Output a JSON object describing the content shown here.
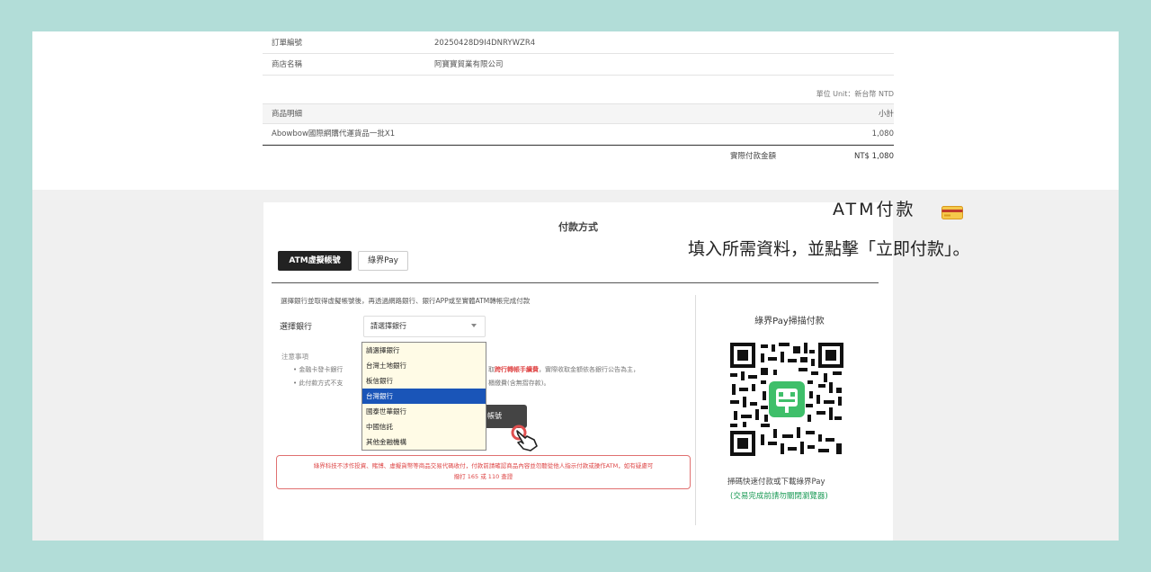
{
  "order": {
    "rows": [
      {
        "label": "訂單編號",
        "value": "20250428D9I4DNRYWZR4"
      },
      {
        "label": "商店名稱",
        "value": "阿寶寶貿業有限公司"
      }
    ],
    "unit_label": "單位 Unit：新台幣 NTD",
    "detail_header": {
      "label": "商品明細",
      "subtotal": "小計"
    },
    "item": {
      "name": "Abowbow國際網購代運貨品一批X1",
      "price": "1,080"
    },
    "total": {
      "label": "實際付款金額",
      "value": "NT$ 1,080"
    }
  },
  "payment": {
    "title": "付款方式",
    "tabs": [
      {
        "label": "ATM虛擬帳號",
        "active": true
      },
      {
        "label": "綠界Pay",
        "active": false
      }
    ],
    "instruction": "選擇銀行並取得虛擬帳號後，再透過網路銀行、銀行APP或至實體ATM轉帳完成付款",
    "bank_label": "選擇銀行",
    "bank_select_value": "請選擇銀行",
    "dropdown_options": [
      "請選擇銀行",
      "台灣土地銀行",
      "板信銀行",
      "台灣銀行",
      "國泰世華銀行",
      "中國信託",
      "其他金融機構"
    ],
    "dropdown_selected_index": 3,
    "notes_title": "注意事項",
    "note1_pre": "• 金融卡發卡銀行",
    "note1_mid": "取",
    "note1_red": "跨行轉帳手續費",
    "note1_post": "，實際收取金額依各銀行公告為主，",
    "note2_pre": "• 此付款方式不支",
    "note2_post": "櫃繳費(含無摺存款)。",
    "generate_button_tail": "帳號",
    "warning_line1": "綠界科技不涉作投資、賭博、虛擬貨幣等商品交易代碼收付，付款前請確認商品內容並勿聽從他人指示付款或操作ATM，如有疑慮可",
    "warning_line2": "撥打 165 或 110 查證",
    "qr_title": "綠界Pay掃描付款",
    "qr_caption": "掃碼快速付款或下載綠界Pay",
    "qr_caption2": "(交易完成前請勿關閉瀏覽器)"
  },
  "annotation": {
    "title": "ATM付款",
    "subtitle": "填入所需資料，並點擊「立即付款」。",
    "icon": "credit-card-icon"
  },
  "colors": {
    "background": "#b2ddd8",
    "accent_dark": "#222222",
    "warning_red": "#e04b4b",
    "selection_blue": "#1a55b8",
    "ecpay_green": "#1a9a55"
  }
}
